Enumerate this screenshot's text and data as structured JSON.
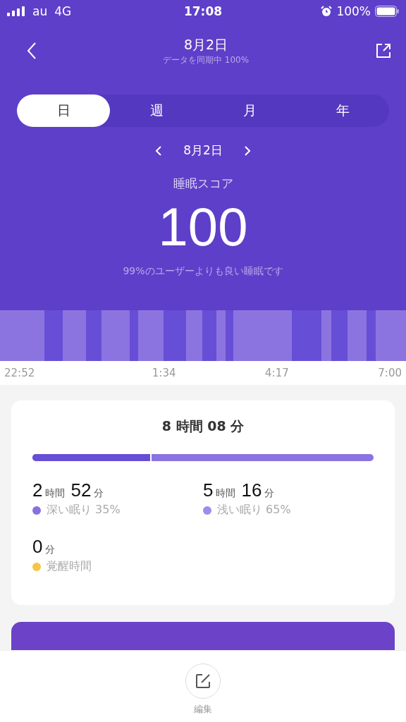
{
  "status_bar": {
    "carrier": "au",
    "network": "4G",
    "time": "17:08",
    "battery": "100%"
  },
  "header": {
    "title": "8月2日",
    "subtitle": "データを同期中 100%"
  },
  "tabs": [
    {
      "label": "日",
      "selected": true
    },
    {
      "label": "週",
      "selected": false
    },
    {
      "label": "月",
      "selected": false
    },
    {
      "label": "年",
      "selected": false
    }
  ],
  "date_nav": {
    "date": "8月2日"
  },
  "score": {
    "label": "睡眠スコア",
    "value": "100",
    "comparison": "99%のユーザーよりも良い睡眠です"
  },
  "timeline": {
    "kind": "picture",
    "times": [
      "22:52",
      "1:34",
      "4:17",
      "7:00"
    ]
  },
  "summary": {
    "total": "8 時間 08 分",
    "deep_share": {
      "level": 0.35
    },
    "stats": [
      {
        "hours": "2",
        "hour_unit": "時間",
        "minutes": "52",
        "minute_unit": "分",
        "label": "深い眠り 35%",
        "color": "#8a6fe3"
      },
      {
        "hours": "5",
        "hour_unit": "時間",
        "minutes": "16",
        "minute_unit": "分",
        "label": "浅い眠り 65%",
        "color": "#a08aea"
      },
      {
        "minutes": "0",
        "minute_unit": "分",
        "label": "覚醒時間",
        "color": "#f6c545"
      }
    ]
  },
  "bottom_bar": {
    "edit_label": "編集"
  }
}
